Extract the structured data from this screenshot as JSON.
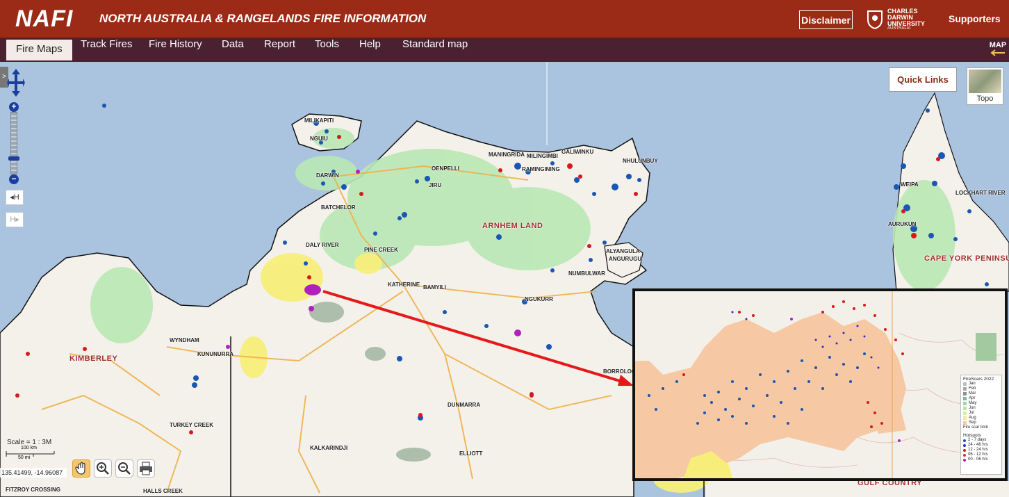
{
  "header": {
    "logo": "NAFI",
    "title": "NORTH AUSTRALIA & RANGELANDS FIRE INFORMATION",
    "disclaimer": "Disclaimer",
    "cdu_lines": [
      "CHARLES",
      "DARWIN",
      "UNIVERSITY"
    ],
    "cdu_sub": "AUSTRALIA",
    "supporters": "Supporters",
    "bg_color": "#9b2b16"
  },
  "nav": {
    "items": [
      {
        "label": "Fire Maps",
        "active": true
      },
      {
        "label": "Track Fires"
      },
      {
        "label": "Fire History"
      },
      {
        "label": "Data"
      },
      {
        "label": "Report"
      },
      {
        "label": "Tools"
      },
      {
        "label": "Help"
      },
      {
        "label": "Standard map"
      }
    ],
    "map_switch": "MAP",
    "bg_color": "#4a2131"
  },
  "map": {
    "quick_links": "Quick Links",
    "topo_label": "Topo",
    "history_back": "◂H",
    "history_forward": "H▸",
    "sidebar_toggle": ">",
    "zoom_in": "+",
    "zoom_out": "−",
    "scale_label": "Scale = 1 : 3M",
    "scale_km": "100 km",
    "scale_mi": "50 mi",
    "coordinates": "135.41499, -14.96087",
    "places": [
      "MILIKAPITI",
      "NGUIU",
      "DARWIN",
      "BATCHELOR",
      "DALY RIVER",
      "PINE CREEK",
      "KATHERINE",
      "BAMYILI",
      "OENPELLI",
      "MANINGRIDA",
      "MILINGIMBI",
      "RAMINGINING",
      "GALIWINKU",
      "NHULUNBUY",
      "ALYANGULA",
      "ANGURUGU",
      "NUMBULWAR",
      "NGUKURR",
      "WYNDHAM",
      "KUNUNURRA",
      "TURKEY CREEK",
      "KALKARINDJI",
      "DUNMARRA",
      "ELLIOTT",
      "BORROLOOLA",
      "FITZROY CROSSING",
      "HALLS CREEK",
      "LOCKHART RIVER",
      "AURUKUN",
      "WEIPA",
      "JIRU"
    ],
    "regions": [
      "ARNHEM LAND",
      "KIMBERLEY",
      "CAPE YORK PENINSULA",
      "GULF COUNTRY"
    ],
    "colors": {
      "sea": "#aac3df",
      "land": "#f4f1ea",
      "scar_recent": "#b9e8b4",
      "scar_yellow": "#f7ee7a",
      "hotspot_blue": "#1a56b4",
      "hotspot_red": "#d7191c",
      "hotspot_purple": "#b21fbf",
      "road": "#f0b14a",
      "arrow": "#e51919"
    }
  },
  "inset": {
    "legend": {
      "firescars_title": "FireScars 2022",
      "months": [
        {
          "label": "Jan",
          "color": "#bdbdbd"
        },
        {
          "label": "Feb",
          "color": "#a8a8a8"
        },
        {
          "label": "Mar",
          "color": "#8f8f8f"
        },
        {
          "label": "Apr",
          "color": "#7fb9a1"
        },
        {
          "label": "May",
          "color": "#9fd6b0"
        },
        {
          "label": "Jun",
          "color": "#b3e3a8"
        },
        {
          "label": "Jul",
          "color": "#d6efa0"
        },
        {
          "label": "Aug",
          "color": "#f1ee86"
        },
        {
          "label": "Sep",
          "color": "#f6ca9d"
        }
      ],
      "limit_label": "Fire scar limit",
      "hotspots_title": "Hotspots",
      "hotspots": [
        {
          "label": "2 - 7 days",
          "color": "#1a56b4"
        },
        {
          "label": "24 - 48 hrs",
          "color": "#2a2ad0"
        },
        {
          "label": "12 - 24 hrs",
          "color": "#d7191c"
        },
        {
          "label": "06 - 12 hrs",
          "color": "#e0331a"
        },
        {
          "label": "00 - 06 hrs",
          "color": "#b21fbf"
        }
      ]
    }
  }
}
